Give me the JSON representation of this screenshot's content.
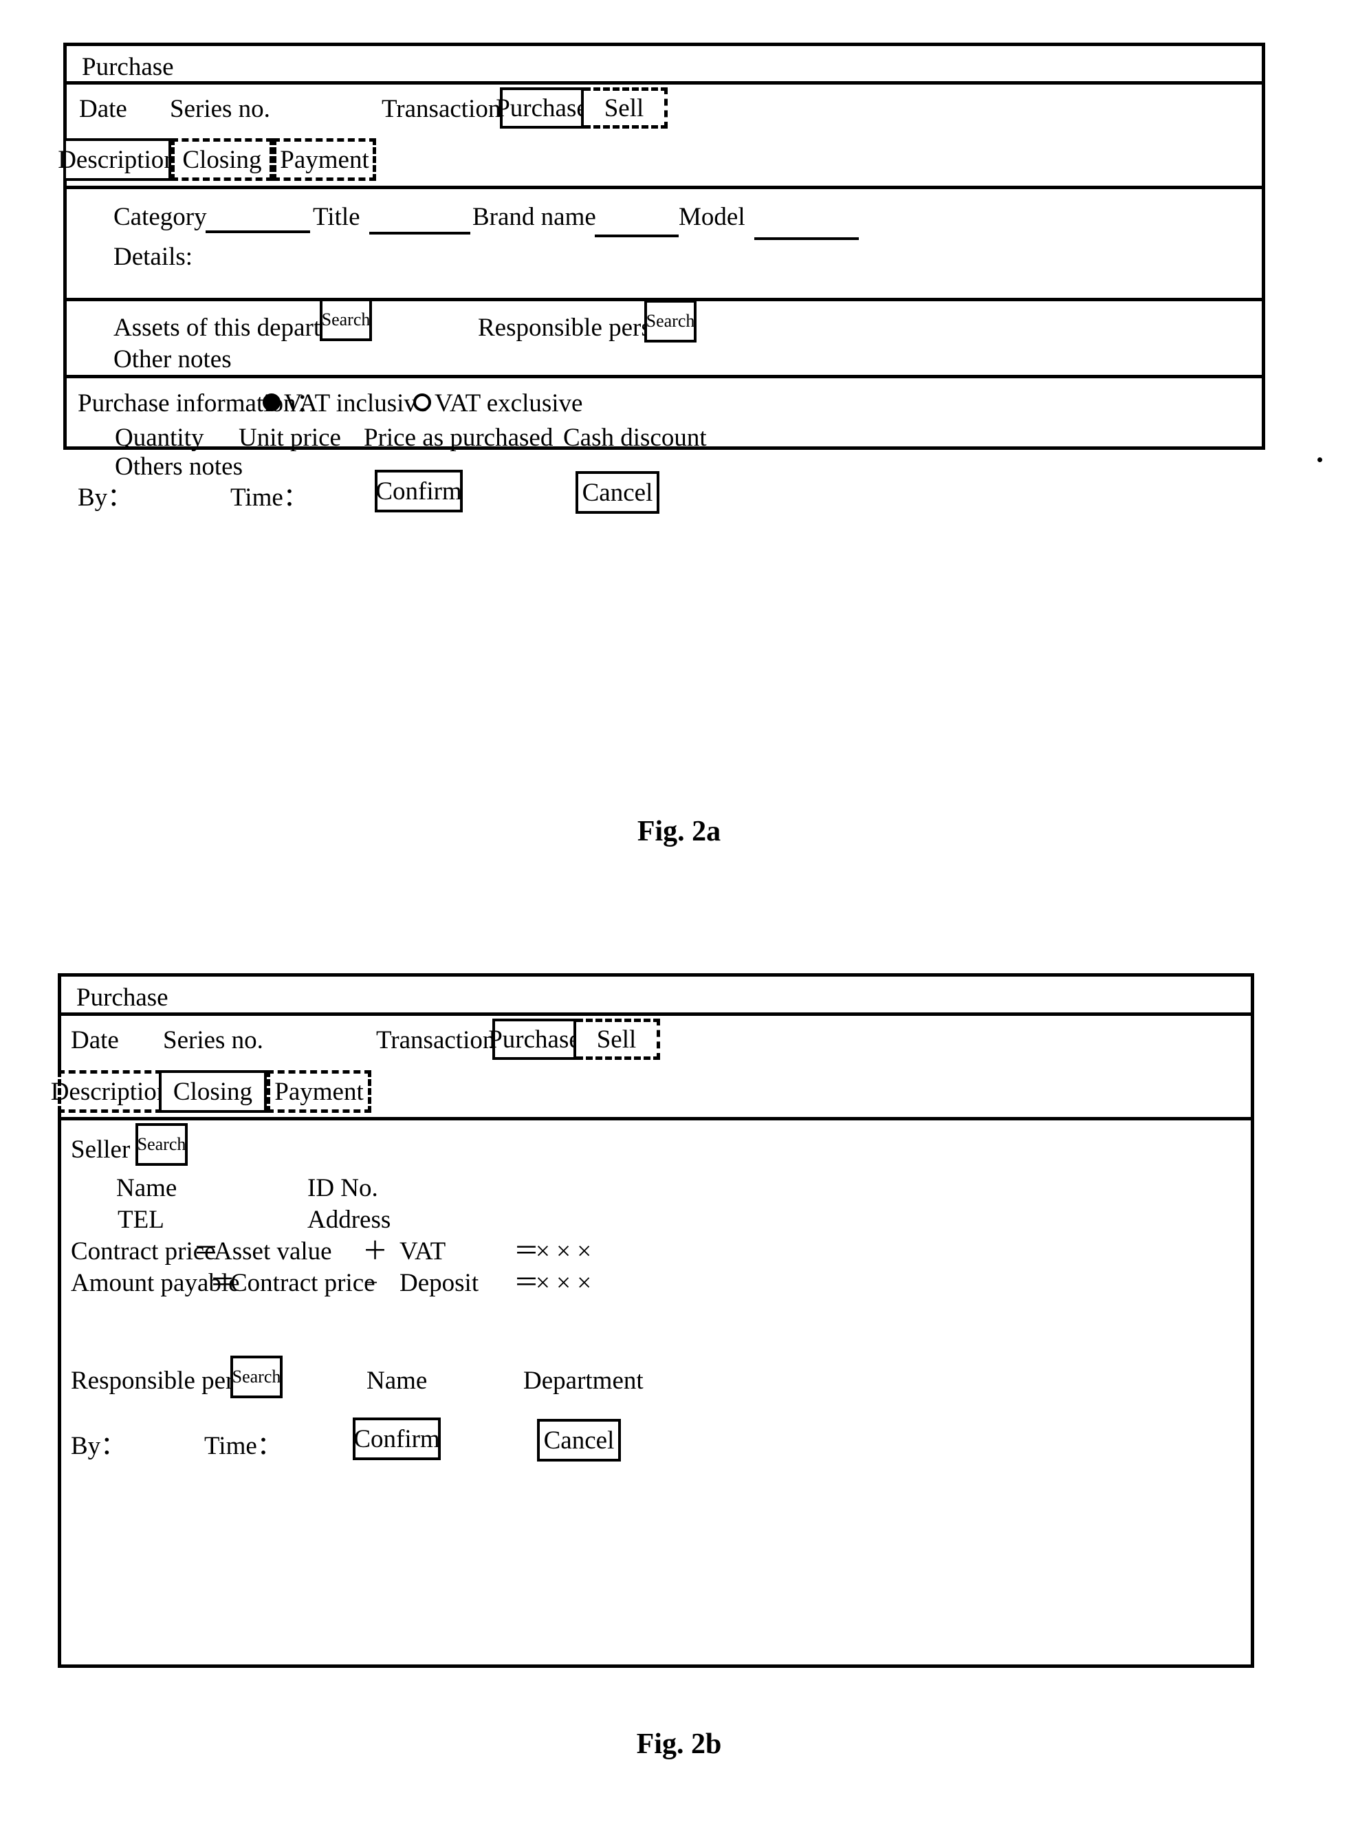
{
  "figures": [
    {
      "caption": "Fig. 2a",
      "title": "Purchase",
      "header": {
        "date_label": "Date",
        "series_label": "Series no.",
        "transaction_label": "Transaction：",
        "transaction_options": [
          "Purchase",
          "Sell"
        ],
        "transaction_selected": "Purchase"
      },
      "tabs": [
        {
          "label": "Description",
          "active": true
        },
        {
          "label": "Closing",
          "active": false
        },
        {
          "label": "Payment",
          "active": false
        }
      ],
      "description_tab": {
        "fields": [
          {
            "label": "Category",
            "value": ""
          },
          {
            "label": "Title",
            "value": ""
          },
          {
            "label": "Brand name",
            "value": ""
          },
          {
            "label": "Model",
            "value": ""
          }
        ],
        "details_label": "Details:",
        "details_value": ""
      },
      "assets_section": {
        "assets_label": "Assets of this department",
        "assets_search": "Search",
        "responsible_label": "Responsible  person",
        "responsible_search": "Search",
        "other_notes_label": "Other notes"
      },
      "purchase_info": {
        "heading": "Purchase information：",
        "vat_options": [
          {
            "label": "VAT inclusive",
            "selected": true
          },
          {
            "label": "VAT exclusive",
            "selected": false
          }
        ],
        "columns": [
          "Quantity",
          "Unit price",
          "Price as purchased",
          "Cash discount"
        ],
        "others_notes_label": "Others notes"
      },
      "footer": {
        "by_label": "By：",
        "time_label": "Time：",
        "confirm_label": "Confirm",
        "cancel_label": "Cancel"
      }
    },
    {
      "caption": "Fig. 2b",
      "title": "Purchase",
      "header": {
        "date_label": "Date",
        "series_label": "Series no.",
        "transaction_label": "Transaction：",
        "transaction_options": [
          "Purchase",
          "Sell"
        ],
        "transaction_selected": "Purchase"
      },
      "tabs": [
        {
          "label": "Description",
          "active": false
        },
        {
          "label": "Closing",
          "active": true
        },
        {
          "label": "Payment",
          "active": false
        }
      ],
      "closing_tab": {
        "seller_label": "Seller",
        "seller_search": "Search",
        "seller_fields": [
          {
            "label": "Name",
            "value": ""
          },
          {
            "label": "ID No.",
            "value": ""
          },
          {
            "label": "TEL",
            "value": ""
          },
          {
            "label": "Address",
            "value": ""
          }
        ],
        "formulas": [
          {
            "result_label": "Contract price",
            "eq": "＝",
            "operand_a": "Asset value",
            "operator": "＋",
            "operand_b": "VAT",
            "total_eq": "＝",
            "total_value": "× × ×"
          },
          {
            "result_label": "Amount payable",
            "eq": "＝",
            "operand_a": "Contract price",
            "operator": "−",
            "operand_b": "Deposit",
            "total_eq": "＝",
            "total_value": "× × ×"
          }
        ],
        "responsible_label": "Responsible person",
        "responsible_search": "Search",
        "responsible_name_label": "Name",
        "responsible_department_label": "Department"
      },
      "footer": {
        "by_label": "By：",
        "time_label": "Time：",
        "confirm_label": "Confirm",
        "cancel_label": "Cancel"
      }
    }
  ]
}
